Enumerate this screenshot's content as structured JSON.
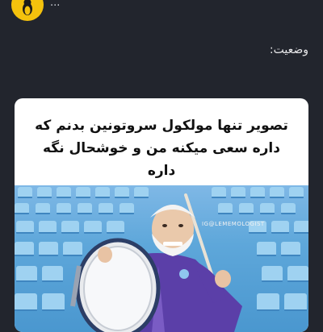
{
  "channel": {
    "name": "...",
    "avatar_icon": "penguin-icon",
    "avatar_color": "#f4c20d"
  },
  "status": {
    "label": "وضعیت:"
  },
  "post": {
    "caption": "تصویر تنها مولکول سروتونین بدنم که داره سعی میکنه من و خوشحال نگه داره",
    "watermark": "IG@LEMEMOLOGIST"
  },
  "colors": {
    "background": "#22252d",
    "card": "#ffffff",
    "jacket": "#5b3fa8"
  }
}
